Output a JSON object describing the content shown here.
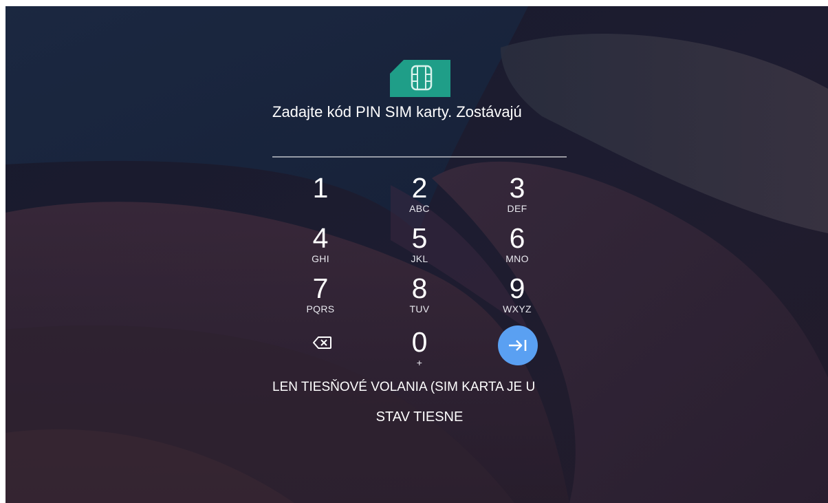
{
  "colors": {
    "sim_icon": "#1f9e88",
    "enter_button": "#5aa0f2",
    "text": "#ffffff"
  },
  "sim": {
    "icon": "sim-card-icon",
    "prompt": "Zadajte kód PIN SIM karty. Zostávajú"
  },
  "keypad": {
    "keys": [
      {
        "digit": "1",
        "letters": ""
      },
      {
        "digit": "2",
        "letters": "ABC"
      },
      {
        "digit": "3",
        "letters": "DEF"
      },
      {
        "digit": "4",
        "letters": "GHI"
      },
      {
        "digit": "5",
        "letters": "JKL"
      },
      {
        "digit": "6",
        "letters": "MNO"
      },
      {
        "digit": "7",
        "letters": "PQRS"
      },
      {
        "digit": "8",
        "letters": "TUV"
      },
      {
        "digit": "9",
        "letters": "WXYZ"
      },
      {
        "digit": "0",
        "letters": "+"
      }
    ],
    "backspace_icon": "backspace-icon",
    "enter_icon": "arrow-right-to-bar-icon"
  },
  "footer": {
    "emergency_only": "LEN TIESŇOVÉ VOLANIA (SIM KARTA JE U",
    "emergency_button": "STAV TIESNE"
  }
}
